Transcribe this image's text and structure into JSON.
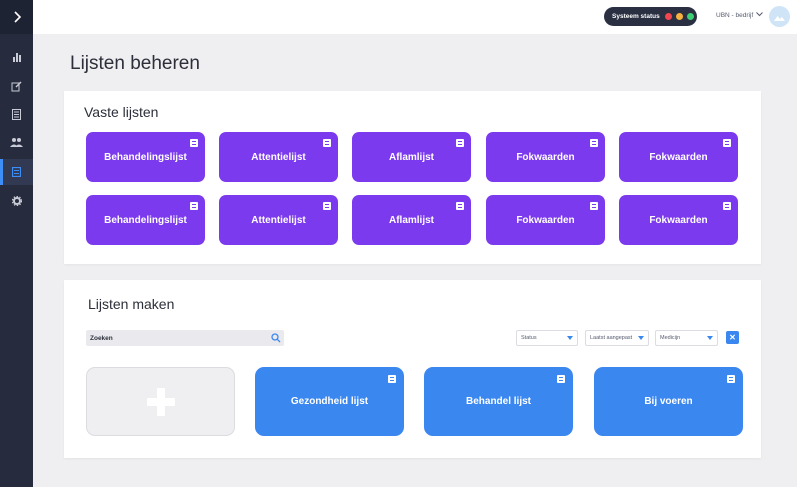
{
  "header": {
    "system_status_label": "Systeem status",
    "status_colors": [
      "#f2464f",
      "#f6b13f",
      "#3dcd73"
    ],
    "company": "UBN - bedrijf"
  },
  "sidebar": {
    "items": [
      {
        "icon": "bar-chart-icon"
      },
      {
        "icon": "edit-icon"
      },
      {
        "icon": "document-icon"
      },
      {
        "icon": "users-icon"
      },
      {
        "icon": "list-icon",
        "active": true
      },
      {
        "icon": "gear-icon"
      }
    ]
  },
  "page": {
    "title": "Lijsten beheren"
  },
  "fixed_lists": {
    "title": "Vaste lijsten",
    "tiles": [
      "Behandelingslijst",
      "Attentielijst",
      "Aflamlijst",
      "Fokwaarden",
      "Fokwaarden",
      "Behandelingslijst",
      "Attentielijst",
      "Aflamlijst",
      "Fokwaarden",
      "Fokwaarden"
    ]
  },
  "make_lists": {
    "title": "Lijsten maken",
    "search_placeholder": "Zoeken",
    "filters": [
      "Status",
      "Laatst aangepast",
      "Medicijn"
    ],
    "tiles": [
      "Gezondheid lijst",
      "Behandel lijst",
      "Bij voeren"
    ]
  },
  "colors": {
    "purple": "#7c3aee",
    "blue": "#3b87f0",
    "sidebar": "#262c3e"
  }
}
